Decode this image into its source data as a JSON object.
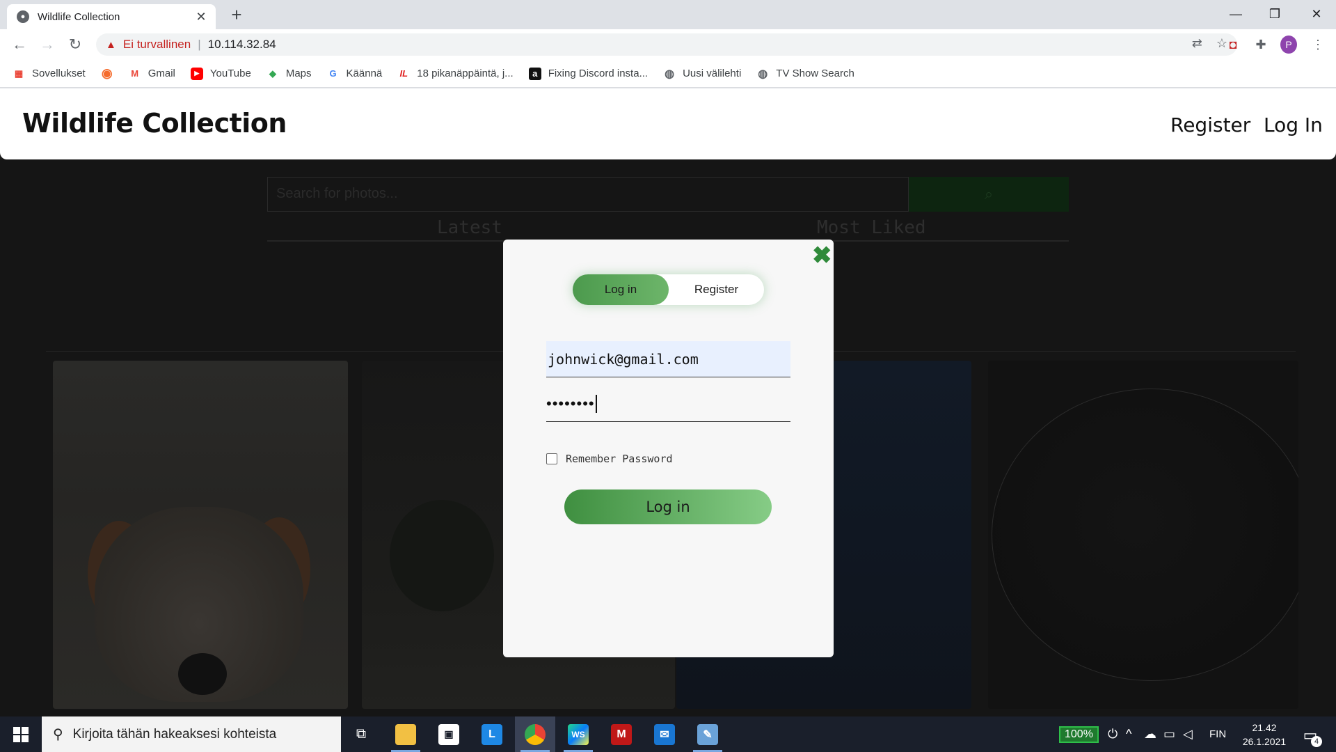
{
  "browser": {
    "tab_title": "Wildlife Collection",
    "new_tab": "+",
    "security_label": "Ei turvallinen",
    "url": "10.114.32.84",
    "profile_initial": "P"
  },
  "bookmarks": [
    {
      "label": "Sovellukset",
      "icon": "apps-grid-icon"
    },
    {
      "label": "",
      "icon": "origin-icon"
    },
    {
      "label": "Gmail",
      "icon": "gmail-icon"
    },
    {
      "label": "YouTube",
      "icon": "youtube-icon"
    },
    {
      "label": "Maps",
      "icon": "maps-icon"
    },
    {
      "label": "Käännä",
      "icon": "translate-icon"
    },
    {
      "label": "18 pikanäppäintä, j...",
      "icon": "il-icon"
    },
    {
      "label": "Fixing Discord insta...",
      "icon": "a-icon"
    },
    {
      "label": "Uusi välilehti",
      "icon": "globe-icon"
    },
    {
      "label": "TV Show Search",
      "icon": "globe-icon"
    }
  ],
  "site": {
    "brand": "Wildlife Collection",
    "nav_register": "Register",
    "nav_login": "Log In",
    "search_placeholder": "Search for photos...",
    "tab_latest": "Latest",
    "tab_most_liked": "Most Liked"
  },
  "modal": {
    "segment_login": "Log in",
    "segment_register": "Register",
    "email_value": "johnwick@gmail.com",
    "password_mask": "••••••••",
    "remember_label": "Remember Password",
    "remember_checked": false,
    "submit_label": "Log in",
    "accent_color": "#4c9a4d"
  },
  "taskbar": {
    "search_placeholder": "Kirjoita tähän hakeaksesi kohteista",
    "battery": "100%",
    "language": "FIN",
    "time": "21.42",
    "date": "26.1.2021",
    "notifications": "4"
  }
}
